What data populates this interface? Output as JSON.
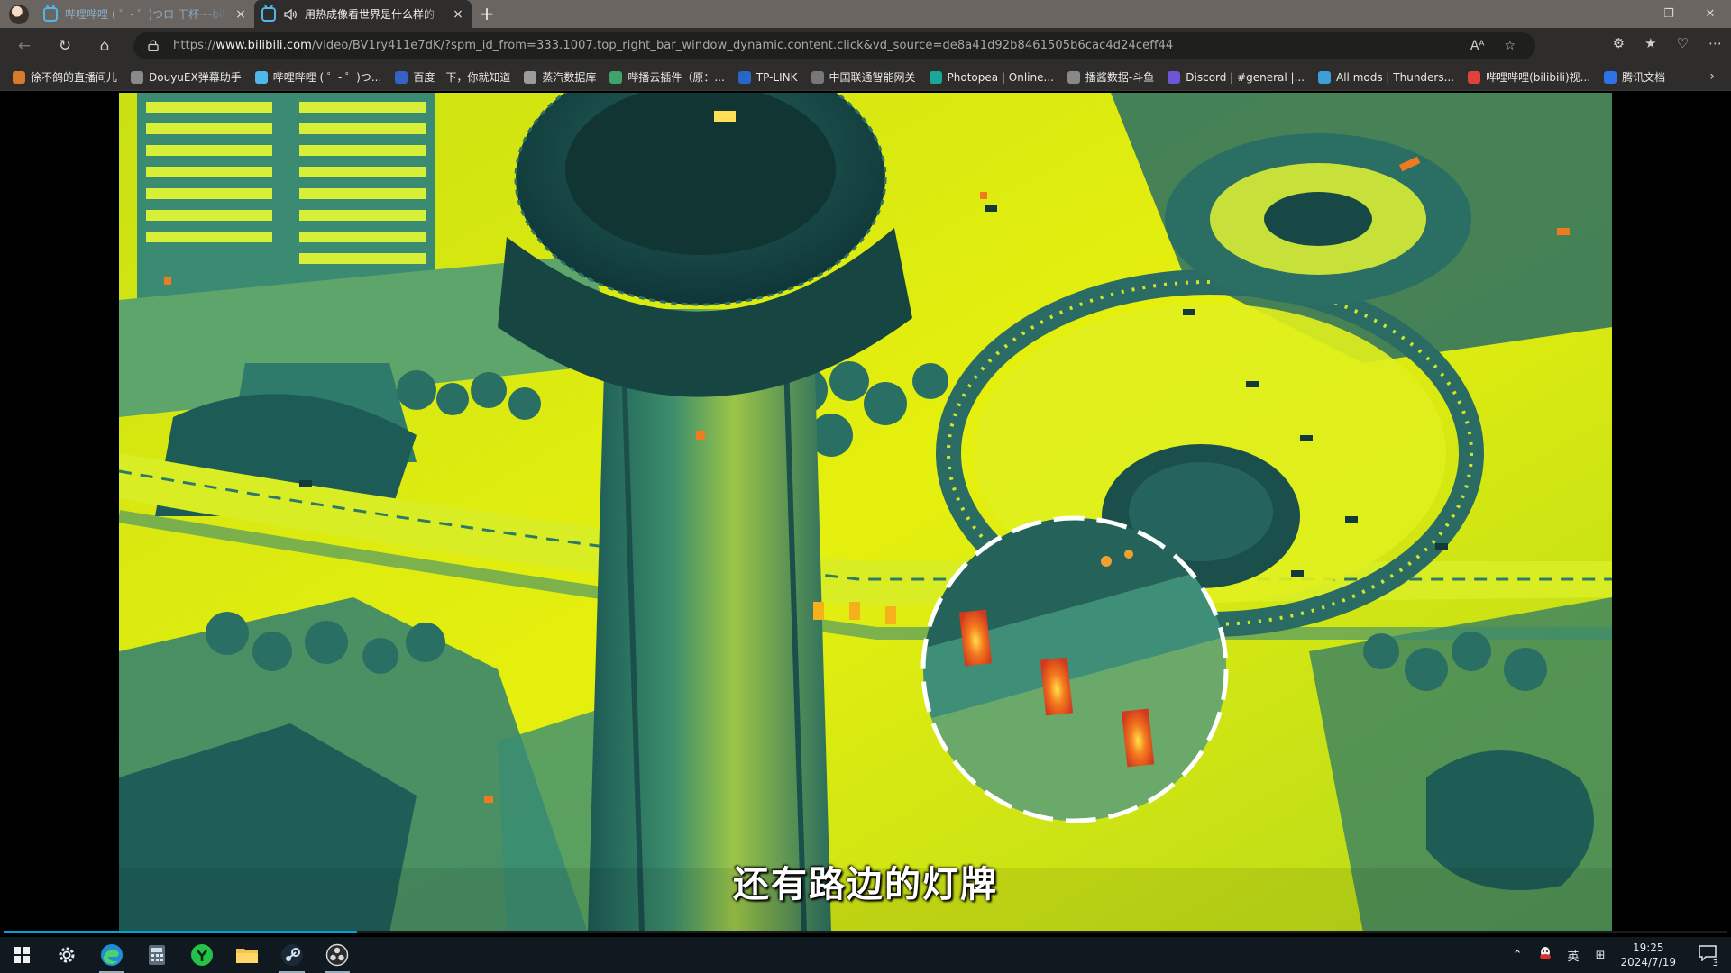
{
  "browser": {
    "tabs": [
      {
        "title": "哔哩哔哩 ( ゜- ゜)つロ 干杯~-bilibili",
        "active": false
      },
      {
        "title": "用热成像看世界是什么样的",
        "active": true
      }
    ],
    "new_tab_label": "+",
    "close_label": "×",
    "url": {
      "prefix": "https://",
      "domain": "www.bilibili.com",
      "rest": "/video/BV1ry411e7dK/?spm_id_from=333.1007.top_right_bar_window_dynamic.content.click&vd_source=de8a41d92b8461505b6cac4d24ceff44"
    },
    "bookmarks": [
      {
        "label": "徐不鸽的直播间儿",
        "icon": "user-icon",
        "color": "#d87b28"
      },
      {
        "label": "DouyuEX弹幕助手",
        "icon": "puzzle-icon",
        "color": "#8a8a8a"
      },
      {
        "label": "哔哩哔哩 ( ゜- ゜)つ...",
        "icon": "bilibili-icon",
        "color": "#4fb8ea"
      },
      {
        "label": "百度一下，你就知道",
        "icon": "baidu-icon",
        "color": "#3860c9"
      },
      {
        "label": "蒸汽数据库",
        "icon": "database-icon",
        "color": "#9b9b9b"
      },
      {
        "label": "哔播云插件（原：...",
        "icon": "leaf-icon",
        "color": "#3fa46b"
      },
      {
        "label": "TP-LINK",
        "icon": "tplink-icon",
        "color": "#2a66c6"
      },
      {
        "label": "中国联通智能网关",
        "icon": "page-icon",
        "color": "#777777"
      },
      {
        "label": "Photopea | Online...",
        "icon": "photopea-icon",
        "color": "#1aa79a"
      },
      {
        "label": "播酱数据-斗鱼",
        "icon": "globe-icon",
        "color": "#888888"
      },
      {
        "label": "Discord | #general |...",
        "icon": "discord-icon",
        "color": "#6d56d6"
      },
      {
        "label": "All mods | Thunders...",
        "icon": "thunderstore-icon",
        "color": "#3aa0d6"
      },
      {
        "label": "哔哩哔哩(bilibili)视...",
        "icon": "bilibili-red-icon",
        "color": "#e0413a"
      },
      {
        "label": "腾讯文档",
        "icon": "tencent-docs-icon",
        "color": "#2e72e8"
      }
    ]
  },
  "video": {
    "subtitle": "还有路边的灯牌",
    "progress_fraction": 0.205
  },
  "taskbar": {
    "apps": [
      "start-icon",
      "settings-icon",
      "edge-icon",
      "calculator-icon",
      "green-app-icon",
      "file-explorer-icon",
      "steam-icon",
      "obs-icon"
    ],
    "ime_label": "英",
    "time": "19:25",
    "date": "2024/7/19",
    "notification_count": "3"
  }
}
